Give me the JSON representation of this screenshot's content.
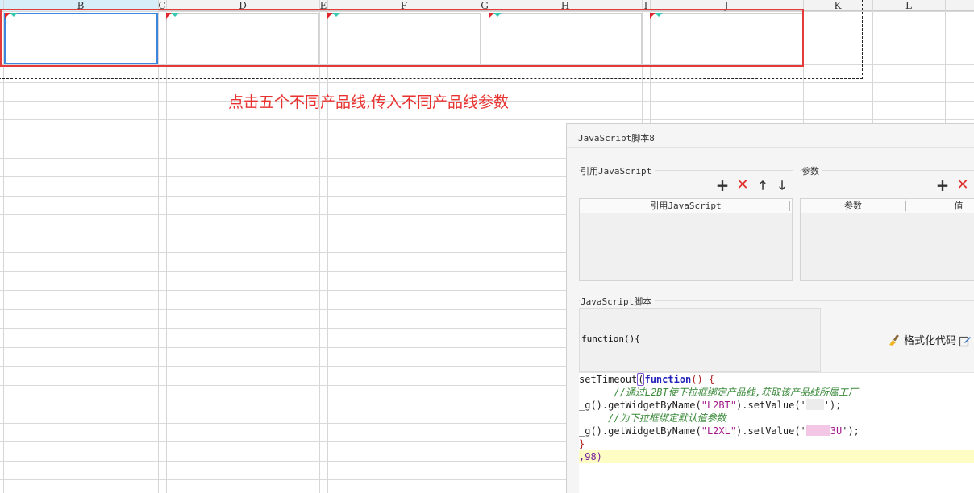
{
  "sheet": {
    "columns": [
      "B",
      "C",
      "D",
      "E",
      "F",
      "G",
      "H",
      "I",
      "J",
      "K",
      "L"
    ],
    "annotation": "点击五个不同产品线,传入不同产品线参数"
  },
  "dialog": {
    "title": "JavaScript脚本8",
    "ref_section_label": "引用JavaScript",
    "param_section_label": "参数",
    "ref_table_header": "引用JavaScript",
    "param_table_headers": [
      "参数",
      "值"
    ],
    "script_section_label": "JavaScript脚本",
    "function_header": "function(){",
    "format_button": "格式化代码",
    "toolbar_icons": [
      "plus-icon",
      "delete-icon",
      "arrow-up-icon",
      "arrow-down-icon"
    ],
    "code": {
      "line1_a": "setTimeout",
      "line1_paren": "(",
      "line1_kw": "function",
      "line1_b": "() {",
      "line2": "      //通过L2BT使下拉框绑定产品线,获取该产品线所属工厂",
      "line3_a": "_g().getWidgetByName(",
      "line3_str": "\"L2BT\"",
      "line3_b": ").setValue('",
      "line3_c": "');",
      "line4": "     //为下拉框绑定默认值参数",
      "line5_a": "_g().getWidgetByName(",
      "line5_str": "\"L2XL\"",
      "line5_b": ").setValue('",
      "line5_visible": "3U",
      "line5_c": "');",
      "line6": "}",
      "line7": ",98)"
    }
  },
  "colors": {
    "annotation_red": "#e8322f",
    "selection_blue": "#3d86de",
    "delete_red": "#e0312c",
    "highlight_line": "#fdfdc4"
  }
}
